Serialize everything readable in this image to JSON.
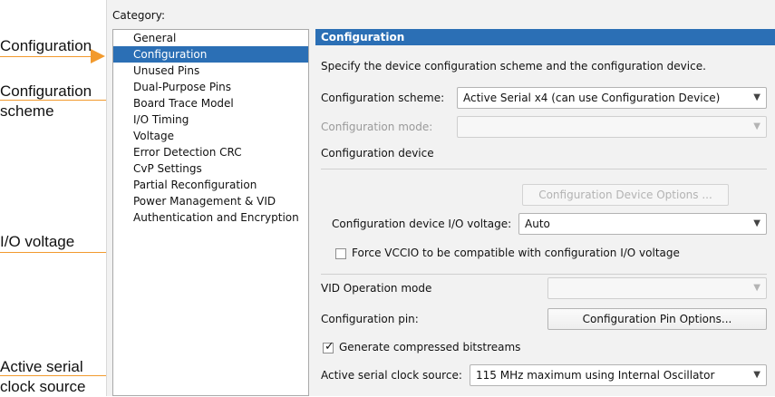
{
  "callouts": [
    {
      "lines": [
        "Configuration"
      ]
    },
    {
      "lines": [
        "Configuration",
        "scheme"
      ]
    },
    {
      "lines": [
        "I/O voltage"
      ]
    },
    {
      "lines": [
        "Active serial",
        "clock source"
      ]
    }
  ],
  "dialog": {
    "category_label": "Category:",
    "categories": [
      "General",
      "Configuration",
      "Unused Pins",
      "Dual-Purpose Pins",
      "Board Trace Model",
      "I/O Timing",
      "Voltage",
      "Error Detection CRC",
      "CvP Settings",
      "Partial Reconfiguration",
      "Power Management & VID",
      "Authentication and Encryption"
    ],
    "selected_category_index": 1,
    "page": {
      "header": "Configuration",
      "description": "Specify the device configuration scheme and the configuration device.",
      "scheme_label": "Configuration scheme:",
      "scheme_value": "Active Serial x4 (can use Configuration Device)",
      "mode_label": "Configuration mode:",
      "mode_value": "",
      "device_section_title": "Configuration device",
      "device_options_button": "Configuration Device Options ...",
      "io_voltage_label": "Configuration device I/O voltage:",
      "io_voltage_value": "Auto",
      "force_vccio_label": "Force VCCIO to be compatible with configuration I/O voltage",
      "force_vccio_checked": false,
      "vid_mode_label": "VID Operation mode",
      "vid_mode_value": "",
      "config_pin_label": "Configuration pin:",
      "config_pin_button": "Configuration Pin Options...",
      "gen_compressed_label": "Generate compressed bitstreams",
      "gen_compressed_checked": true,
      "clock_source_label": "Active serial clock source:",
      "clock_source_value": "115 MHz maximum using Internal Oscillator"
    }
  },
  "icons": {
    "dropdown": "chevron-down-icon",
    "checkbox": "checkbox-icon",
    "arrow": "arrow-right-icon"
  },
  "colors": {
    "accent": "#2b6fb5",
    "orange": "#f29a2e",
    "panel": "#f2f2f2"
  }
}
